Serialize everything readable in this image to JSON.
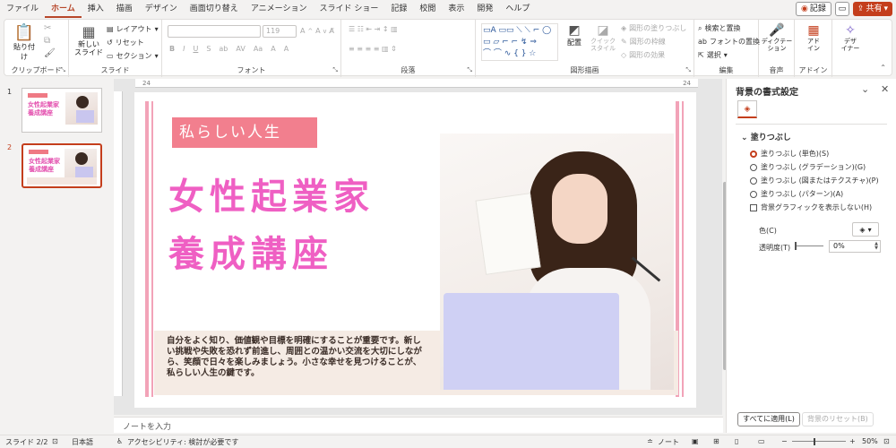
{
  "tabs": [
    "ファイル",
    "ホーム",
    "挿入",
    "描画",
    "デザイン",
    "画面切り替え",
    "アニメーション",
    "スライド ショー",
    "記録",
    "校閲",
    "表示",
    "開発",
    "ヘルプ"
  ],
  "active_tab": "ホーム",
  "header_right": {
    "record": "記録",
    "share": "共有"
  },
  "ribbon": {
    "clipboard": {
      "paste": "貼り付け",
      "label": "クリップボード"
    },
    "slides": {
      "new_slide": "新しい\nスライド",
      "layout": "レイアウト",
      "reset": "リセット",
      "section": "セクション",
      "label": "スライド"
    },
    "font": {
      "size": "119",
      "label": "フォント"
    },
    "paragraph": {
      "label": "段落"
    },
    "drawing": {
      "arrange": "配置",
      "quick_style": "クイック\nスタイル",
      "fill": "図形の塗りつぶし",
      "outline": "図形の枠線",
      "effects": "図形の効果",
      "label": "図形描画"
    },
    "editing": {
      "find": "検索と置換",
      "replace_font": "フォントの置換",
      "select": "選択",
      "label": "編集"
    },
    "voice": {
      "dictate": "ディクテー\nション",
      "label": "音声"
    },
    "addins": {
      "addins": "アド\nイン",
      "label": "アドイン"
    },
    "designer": {
      "label": "デザ\nイナー"
    }
  },
  "thumbnails": [
    {
      "num": "1",
      "title": "女性起業家\n養成講座"
    },
    {
      "num": "2",
      "title": "女性起業家\n養成講座"
    }
  ],
  "slide": {
    "badge": "私らしい人生",
    "title_line1": "女性起業家",
    "title_line2": "養成講座",
    "body": "自分をよく知り、価値観や目標を明確にすることが重要です。新しい挑戦や失敗を恐れず前進し、周囲との温かい交流を大切にしながら、笑顔で日々を楽しみましょう。小さな幸せを見つけることが、私らしい人生の鍵です。"
  },
  "ruler": {
    "left": "24",
    "right": "24"
  },
  "notes_placeholder": "ノートを入力",
  "format_pane": {
    "title": "背景の書式設定",
    "section": "塗りつぶし",
    "options": [
      "塗りつぶし (単色)(S)",
      "塗りつぶし (グラデーション)(G)",
      "塗りつぶし (図またはテクスチャ)(P)",
      "塗りつぶし (パターン)(A)"
    ],
    "selected_option": "塗りつぶし (単色)(S)",
    "hide_bg_graphics": "背景グラフィックを表示しない(H)",
    "color_label": "色(C)",
    "transparency_label": "透明度(T)",
    "transparency_value": "0%",
    "apply_all": "すべてに適用(L)",
    "reset_bg": "背景のリセット(B)"
  },
  "status": {
    "slide_info": "スライド 2/2",
    "language": "日本語",
    "accessibility": "アクセシビリティ: 検討が必要です",
    "notes": "ノート",
    "zoom": "50%"
  }
}
